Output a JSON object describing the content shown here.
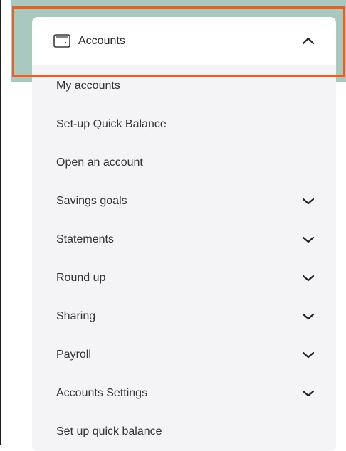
{
  "menu": {
    "header": {
      "label": "Accounts",
      "icon": "wallet-icon",
      "expanded": true,
      "chevron": "chevron-up-icon"
    },
    "items": [
      {
        "label": "My accounts",
        "has_submenu": false
      },
      {
        "label": "Set-up Quick Balance",
        "has_submenu": false
      },
      {
        "label": "Open an account",
        "has_submenu": false
      },
      {
        "label": "Savings goals",
        "has_submenu": true
      },
      {
        "label": "Statements",
        "has_submenu": true
      },
      {
        "label": "Round up",
        "has_submenu": true
      },
      {
        "label": "Sharing",
        "has_submenu": true
      },
      {
        "label": "Payroll",
        "has_submenu": true
      },
      {
        "label": "Accounts Settings",
        "has_submenu": true
      },
      {
        "label": "Set up quick balance",
        "has_submenu": false
      }
    ]
  },
  "colors": {
    "highlight_border": "#ef5d23",
    "backdrop_teal": "#a9c9bf",
    "panel_background": "#f4f4f6"
  }
}
